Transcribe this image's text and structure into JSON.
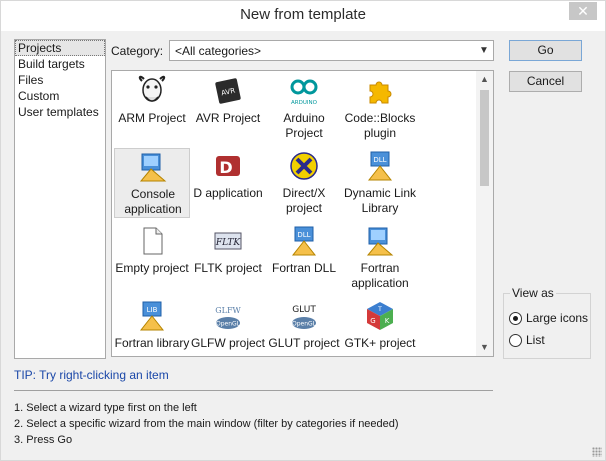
{
  "window": {
    "title": "New from template",
    "close_glyph": "✕"
  },
  "categories_list": {
    "items": [
      {
        "label": "Projects",
        "selected": true
      },
      {
        "label": "Build targets",
        "selected": false
      },
      {
        "label": "Files",
        "selected": false
      },
      {
        "label": "Custom",
        "selected": false
      },
      {
        "label": "User templates",
        "selected": false
      }
    ]
  },
  "category_filter": {
    "label": "Category:",
    "value": "<All categories>"
  },
  "templates": [
    {
      "label": "ARM Project",
      "icon": "gnu-head-icon",
      "selected": false
    },
    {
      "label": "AVR Project",
      "icon": "avr-chip-icon",
      "selected": false
    },
    {
      "label": "Arduino Project",
      "icon": "arduino-logo-icon",
      "icon_text": "ARDUINO",
      "selected": false
    },
    {
      "label": "Code::Blocks plugin",
      "icon": "puzzle-piece-icon",
      "selected": false
    },
    {
      "label": "Console application",
      "icon": "console-app-icon",
      "selected": true
    },
    {
      "label": "D application",
      "icon": "d-language-icon",
      "icon_text": "D",
      "selected": false
    },
    {
      "label": "Direct/X project",
      "icon": "directx-icon",
      "selected": false
    },
    {
      "label": "Dynamic Link Library",
      "icon": "dll-icon",
      "icon_text": "DLL",
      "selected": false
    },
    {
      "label": "Empty project",
      "icon": "blank-document-icon",
      "selected": false
    },
    {
      "label": "FLTK project",
      "icon": "fltk-icon",
      "icon_text": "FLTK",
      "selected": false
    },
    {
      "label": "Fortran DLL",
      "icon": "fortran-dll-icon",
      "icon_text": "DLL",
      "selected": false
    },
    {
      "label": "Fortran application",
      "icon": "fortran-app-icon",
      "selected": false
    },
    {
      "label": "Fortran library",
      "icon": "fortran-lib-icon",
      "icon_text": "LIB",
      "selected": false
    },
    {
      "label": "GLFW project",
      "icon": "glfw-opengl-icon",
      "icon_text": "GLFW",
      "icon_subtext": "OpenGL",
      "selected": false
    },
    {
      "label": "GLUT project",
      "icon": "glut-opengl-icon",
      "icon_text": "GLUT",
      "icon_subtext": "OpenGL",
      "selected": false
    },
    {
      "label": "GTK+ project",
      "icon": "gtk-cube-icon",
      "selected": false
    }
  ],
  "buttons": {
    "go": "Go",
    "cancel": "Cancel"
  },
  "view_as": {
    "legend": "View as",
    "options": [
      {
        "label": "Large icons",
        "checked": true
      },
      {
        "label": "List",
        "checked": false
      }
    ]
  },
  "tip": "TIP: Try right-clicking an item",
  "help": {
    "line1": "1. Select a wizard type first on the left",
    "line2": "2. Select a specific wizard from the main window (filter by categories if needed)",
    "line3": "3. Press Go"
  },
  "colors": {
    "tip_text": "#1a47a8",
    "arduino_teal": "#00979c",
    "d_red": "#b03030",
    "plugin_yellow": "#f5b800"
  }
}
